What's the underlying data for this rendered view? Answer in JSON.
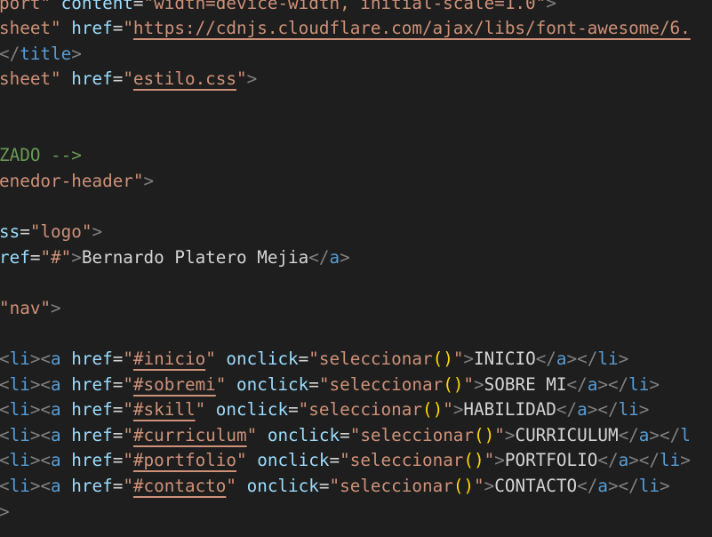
{
  "lines": [
    [
      {
        "t": "port\"",
        "c": "str"
      },
      {
        "t": " ",
        "c": "txt"
      },
      {
        "t": "content",
        "c": "attr"
      },
      {
        "t": "=",
        "c": "txt"
      },
      {
        "t": "\"width=device-width, initial-scale=1.0\"",
        "c": "str"
      },
      {
        "t": ">",
        "c": "tag"
      }
    ],
    [
      {
        "t": "sheet\"",
        "c": "str"
      },
      {
        "t": " ",
        "c": "txt"
      },
      {
        "t": "href",
        "c": "attr"
      },
      {
        "t": "=",
        "c": "txt"
      },
      {
        "t": "\"",
        "c": "str"
      },
      {
        "t": "https://cdnjs.cloudflare.com/ajax/libs/font-awesome/6.",
        "c": "str link"
      }
    ],
    [
      {
        "t": "</",
        "c": "tag"
      },
      {
        "t": "title",
        "c": "tagname"
      },
      {
        "t": ">",
        "c": "tag"
      }
    ],
    [
      {
        "t": "sheet\"",
        "c": "str"
      },
      {
        "t": " ",
        "c": "txt"
      },
      {
        "t": "href",
        "c": "attr"
      },
      {
        "t": "=",
        "c": "txt"
      },
      {
        "t": "\"",
        "c": "str"
      },
      {
        "t": "estilo.css",
        "c": "str link"
      },
      {
        "t": "\"",
        "c": "str"
      },
      {
        "t": ">",
        "c": "tag"
      }
    ],
    [],
    [],
    [
      {
        "t": "ZADO -->",
        "c": "cmt"
      }
    ],
    [
      {
        "t": "enedor-header\"",
        "c": "str"
      },
      {
        "t": ">",
        "c": "tag"
      }
    ],
    [],
    [
      {
        "t": "ss",
        "c": "attr"
      },
      {
        "t": "=",
        "c": "txt"
      },
      {
        "t": "\"logo\"",
        "c": "str"
      },
      {
        "t": ">",
        "c": "tag"
      }
    ],
    [
      {
        "t": "ref",
        "c": "attr"
      },
      {
        "t": "=",
        "c": "txt"
      },
      {
        "t": "\"#\"",
        "c": "str"
      },
      {
        "t": ">",
        "c": "tag"
      },
      {
        "t": "Bernardo Platero Mejia",
        "c": "txt"
      },
      {
        "t": "</",
        "c": "tag"
      },
      {
        "t": "a",
        "c": "tagname"
      },
      {
        "t": ">",
        "c": "tag"
      }
    ],
    [],
    [
      {
        "t": "\"nav\"",
        "c": "str"
      },
      {
        "t": ">",
        "c": "tag"
      }
    ],
    [],
    [
      {
        "t": "<",
        "c": "tag"
      },
      {
        "t": "li",
        "c": "tagname"
      },
      {
        "t": "><",
        "c": "tag"
      },
      {
        "t": "a",
        "c": "tagname"
      },
      {
        "t": " ",
        "c": "txt"
      },
      {
        "t": "href",
        "c": "attr"
      },
      {
        "t": "=",
        "c": "txt"
      },
      {
        "t": "\"",
        "c": "str"
      },
      {
        "t": "#inicio",
        "c": "str link"
      },
      {
        "t": "\"",
        "c": "str"
      },
      {
        "t": " ",
        "c": "txt"
      },
      {
        "t": "onclick",
        "c": "attr"
      },
      {
        "t": "=",
        "c": "txt"
      },
      {
        "t": "\"seleccionar",
        "c": "str"
      },
      {
        "t": "()",
        "c": "paren"
      },
      {
        "t": "\"",
        "c": "str"
      },
      {
        "t": ">",
        "c": "tag"
      },
      {
        "t": "INICIO",
        "c": "txt"
      },
      {
        "t": "</",
        "c": "tag"
      },
      {
        "t": "a",
        "c": "tagname"
      },
      {
        "t": "></",
        "c": "tag"
      },
      {
        "t": "li",
        "c": "tagname"
      },
      {
        "t": ">",
        "c": "tag"
      }
    ],
    [
      {
        "t": "<",
        "c": "tag"
      },
      {
        "t": "li",
        "c": "tagname"
      },
      {
        "t": "><",
        "c": "tag"
      },
      {
        "t": "a",
        "c": "tagname"
      },
      {
        "t": " ",
        "c": "txt"
      },
      {
        "t": "href",
        "c": "attr"
      },
      {
        "t": "=",
        "c": "txt"
      },
      {
        "t": "\"",
        "c": "str"
      },
      {
        "t": "#sobremi",
        "c": "str link"
      },
      {
        "t": "\"",
        "c": "str"
      },
      {
        "t": " ",
        "c": "txt"
      },
      {
        "t": "onclick",
        "c": "attr"
      },
      {
        "t": "=",
        "c": "txt"
      },
      {
        "t": "\"seleccionar",
        "c": "str"
      },
      {
        "t": "()",
        "c": "paren"
      },
      {
        "t": "\"",
        "c": "str"
      },
      {
        "t": ">",
        "c": "tag"
      },
      {
        "t": "SOBRE MI",
        "c": "txt"
      },
      {
        "t": "</",
        "c": "tag"
      },
      {
        "t": "a",
        "c": "tagname"
      },
      {
        "t": "></",
        "c": "tag"
      },
      {
        "t": "li",
        "c": "tagname"
      },
      {
        "t": ">",
        "c": "tag"
      }
    ],
    [
      {
        "t": "<",
        "c": "tag"
      },
      {
        "t": "li",
        "c": "tagname"
      },
      {
        "t": "><",
        "c": "tag"
      },
      {
        "t": "a",
        "c": "tagname"
      },
      {
        "t": " ",
        "c": "txt"
      },
      {
        "t": "href",
        "c": "attr"
      },
      {
        "t": "=",
        "c": "txt"
      },
      {
        "t": "\"",
        "c": "str"
      },
      {
        "t": "#skill",
        "c": "str link"
      },
      {
        "t": "\"",
        "c": "str"
      },
      {
        "t": " ",
        "c": "txt"
      },
      {
        "t": "onclick",
        "c": "attr"
      },
      {
        "t": "=",
        "c": "txt"
      },
      {
        "t": "\"seleccionar",
        "c": "str"
      },
      {
        "t": "()",
        "c": "paren"
      },
      {
        "t": "\"",
        "c": "str"
      },
      {
        "t": ">",
        "c": "tag"
      },
      {
        "t": "HABILIDAD",
        "c": "txt"
      },
      {
        "t": "</",
        "c": "tag"
      },
      {
        "t": "a",
        "c": "tagname"
      },
      {
        "t": "></",
        "c": "tag"
      },
      {
        "t": "li",
        "c": "tagname"
      },
      {
        "t": ">",
        "c": "tag"
      }
    ],
    [
      {
        "t": "<",
        "c": "tag"
      },
      {
        "t": "li",
        "c": "tagname"
      },
      {
        "t": "><",
        "c": "tag"
      },
      {
        "t": "a",
        "c": "tagname"
      },
      {
        "t": " ",
        "c": "txt"
      },
      {
        "t": "href",
        "c": "attr"
      },
      {
        "t": "=",
        "c": "txt"
      },
      {
        "t": "\"",
        "c": "str"
      },
      {
        "t": "#curriculum",
        "c": "str link"
      },
      {
        "t": "\"",
        "c": "str"
      },
      {
        "t": " ",
        "c": "txt"
      },
      {
        "t": "onclick",
        "c": "attr"
      },
      {
        "t": "=",
        "c": "txt"
      },
      {
        "t": "\"seleccionar",
        "c": "str"
      },
      {
        "t": "()",
        "c": "paren"
      },
      {
        "t": "\"",
        "c": "str"
      },
      {
        "t": ">",
        "c": "tag"
      },
      {
        "t": "CURRICULUM",
        "c": "txt"
      },
      {
        "t": "</",
        "c": "tag"
      },
      {
        "t": "a",
        "c": "tagname"
      },
      {
        "t": "></",
        "c": "tag"
      },
      {
        "t": "l",
        "c": "tagname"
      }
    ],
    [
      {
        "t": "<",
        "c": "tag"
      },
      {
        "t": "li",
        "c": "tagname"
      },
      {
        "t": "><",
        "c": "tag"
      },
      {
        "t": "a",
        "c": "tagname"
      },
      {
        "t": " ",
        "c": "txt"
      },
      {
        "t": "href",
        "c": "attr"
      },
      {
        "t": "=",
        "c": "txt"
      },
      {
        "t": "\"",
        "c": "str"
      },
      {
        "t": "#portfolio",
        "c": "str link"
      },
      {
        "t": "\"",
        "c": "str"
      },
      {
        "t": " ",
        "c": "txt"
      },
      {
        "t": "onclick",
        "c": "attr"
      },
      {
        "t": "=",
        "c": "txt"
      },
      {
        "t": "\"seleccionar",
        "c": "str"
      },
      {
        "t": "()",
        "c": "paren"
      },
      {
        "t": "\"",
        "c": "str"
      },
      {
        "t": ">",
        "c": "tag"
      },
      {
        "t": "PORTFOLIO",
        "c": "txt"
      },
      {
        "t": "</",
        "c": "tag"
      },
      {
        "t": "a",
        "c": "tagname"
      },
      {
        "t": "></",
        "c": "tag"
      },
      {
        "t": "li",
        "c": "tagname"
      },
      {
        "t": ">",
        "c": "tag"
      }
    ],
    [
      {
        "t": "<",
        "c": "tag"
      },
      {
        "t": "li",
        "c": "tagname"
      },
      {
        "t": "><",
        "c": "tag"
      },
      {
        "t": "a",
        "c": "tagname"
      },
      {
        "t": " ",
        "c": "txt"
      },
      {
        "t": "href",
        "c": "attr"
      },
      {
        "t": "=",
        "c": "txt"
      },
      {
        "t": "\"",
        "c": "str"
      },
      {
        "t": "#contacto",
        "c": "str link"
      },
      {
        "t": "\"",
        "c": "str"
      },
      {
        "t": " ",
        "c": "txt"
      },
      {
        "t": "onclick",
        "c": "attr"
      },
      {
        "t": "=",
        "c": "txt"
      },
      {
        "t": "\"seleccionar",
        "c": "str"
      },
      {
        "t": "()",
        "c": "paren"
      },
      {
        "t": "\"",
        "c": "str"
      },
      {
        "t": ">",
        "c": "tag"
      },
      {
        "t": "CONTACTO",
        "c": "txt"
      },
      {
        "t": "</",
        "c": "tag"
      },
      {
        "t": "a",
        "c": "tagname"
      },
      {
        "t": "></",
        "c": "tag"
      },
      {
        "t": "li",
        "c": "tagname"
      },
      {
        "t": ">",
        "c": "tag"
      }
    ],
    [
      {
        "t": ">",
        "c": "tag"
      }
    ]
  ]
}
